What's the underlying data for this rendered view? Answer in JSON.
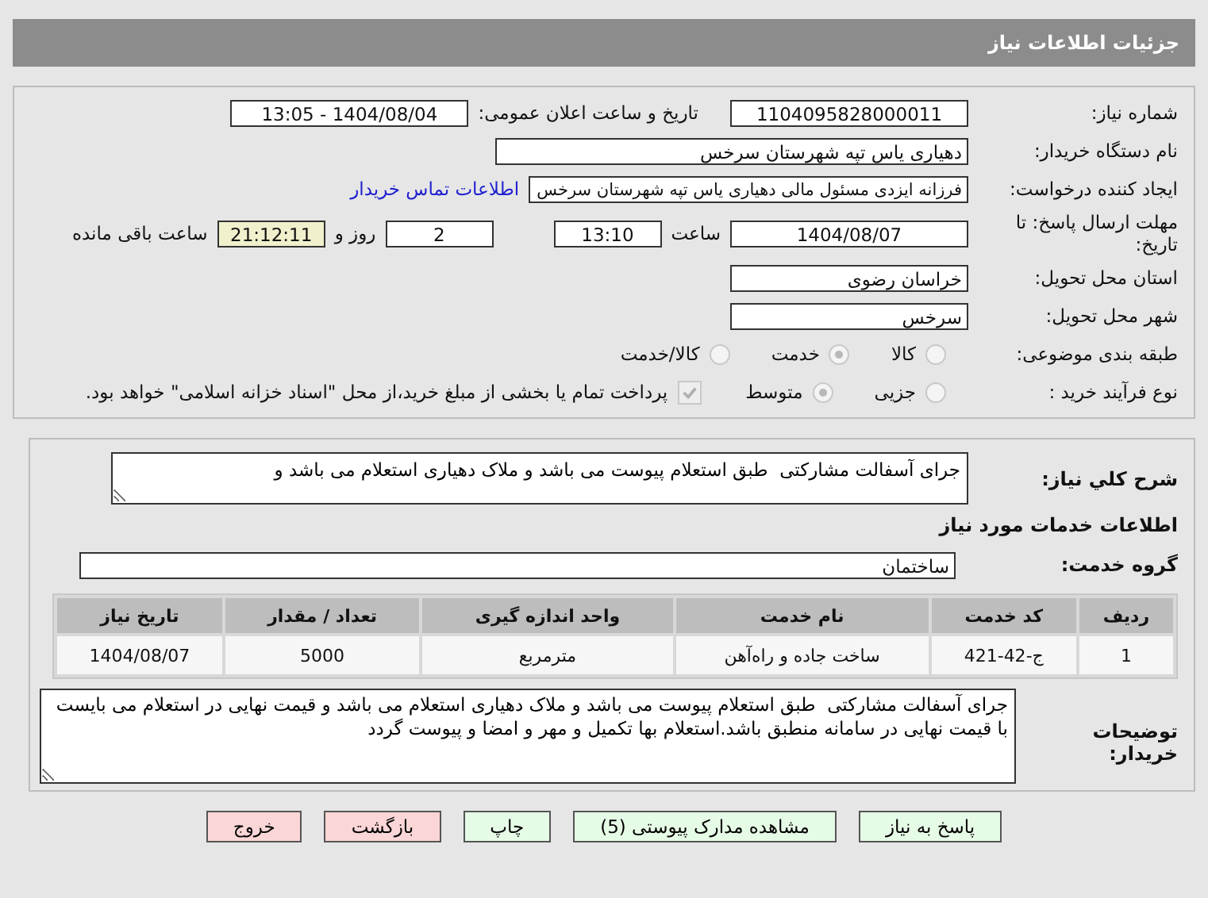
{
  "header": {
    "title": "جزئیات اطلاعات نیاز"
  },
  "fields": {
    "need_number": {
      "label": "شماره نیاز:",
      "value": "1104095828000011"
    },
    "announce": {
      "label": "تاریخ و ساعت اعلان عمومی:",
      "value": "1404/08/04 - 13:05"
    },
    "buyer": {
      "label": "نام دستگاه خریدار:",
      "value": "دهیاری یاس تپه شهرستان سرخس"
    },
    "creator": {
      "label": "ایجاد کننده درخواست:",
      "value": "فرزانه ایزدی مسئول مالی دهیاری یاس تپه شهرستان سرخس",
      "link": "اطلاعات تماس خریدار"
    },
    "deadline": {
      "label": "مهلت ارسال پاسخ: تا تاریخ:",
      "date": "1404/08/07",
      "time_label": "ساعت",
      "time": "13:10",
      "days": "2",
      "days_label": "روز و",
      "remaining": "21:12:11",
      "remaining_label": "ساعت باقی مانده"
    },
    "province": {
      "label": "استان محل تحویل:",
      "value": "خراسان رضوی"
    },
    "city": {
      "label": "شهر محل تحویل:",
      "value": "سرخس"
    }
  },
  "classification": {
    "label": "طبقه بندی موضوعی:",
    "options": [
      {
        "label": "کالا",
        "selected": false
      },
      {
        "label": "خدمت",
        "selected": true
      },
      {
        "label": "کالا/خدمت",
        "selected": false
      }
    ]
  },
  "process": {
    "label": "نوع فرآیند خرید :",
    "options": [
      {
        "label": "جزیی",
        "selected": false
      },
      {
        "label": "متوسط",
        "selected": true
      }
    ],
    "treasury": {
      "label": "پرداخت تمام یا بخشی از مبلغ خرید،از محل \"اسناد خزانه اسلامی\" خواهد بود.",
      "checked": true
    }
  },
  "description": {
    "label": "شرح کلي نياز:",
    "value": "جرای آسفالت مشارکتی  طبق استعلام پیوست می باشد و ملاک دهیاری استعلام می باشد و"
  },
  "services_title": "اطلاعات خدمات مورد نیاز",
  "service_group": {
    "label": "گروه خدمت:",
    "value": "ساختمان"
  },
  "table": {
    "columns": [
      "ردیف",
      "کد خدمت",
      "نام خدمت",
      "واحد اندازه گیری",
      "تعداد / مقدار",
      "تاریخ نیاز"
    ],
    "rows": [
      [
        "1",
        "ج-42-421",
        "ساخت جاده و راه‌آهن",
        "مترمربع",
        "5000",
        "1404/08/07"
      ]
    ]
  },
  "buyer_notes": {
    "label": "توضیحات خریدار:",
    "value": "جرای آسفالت مشارکتی  طبق استعلام پیوست می باشد و ملاک دهیاری استعلام می باشد و قیمت نهایی در استعلام می بایست با قیمت نهایی در سامانه منطبق باشد.استعلام بها تکمیل و مهر و امضا و پیوست گردد"
  },
  "buttons": [
    {
      "label": "پاسخ به نیاز",
      "kind": "normal"
    },
    {
      "label": "مشاهده مدارک پیوستی (5)",
      "kind": "normal"
    },
    {
      "label": "چاپ",
      "kind": "normal"
    },
    {
      "label": "بازگشت",
      "kind": "danger"
    },
    {
      "label": "خروج",
      "kind": "danger"
    }
  ]
}
